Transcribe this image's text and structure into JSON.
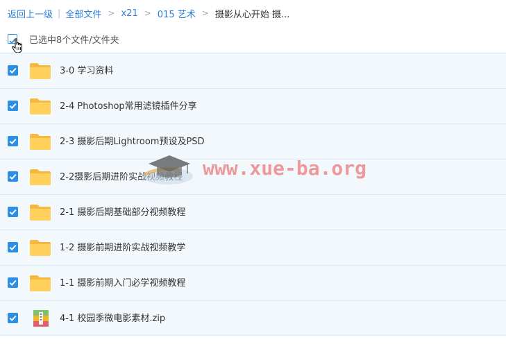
{
  "breadcrumb": {
    "back": "返回上一级",
    "all_files": "全部文件",
    "crumbs": [
      "x21",
      "015 艺术"
    ],
    "current": "摄影从心开始 摄..."
  },
  "selection": {
    "label": "已选中8个文件/文件夹"
  },
  "files": [
    {
      "name": "3-0 学习资料",
      "type": "folder",
      "checked": true
    },
    {
      "name": "2-4 Photoshop常用滤镜插件分享",
      "type": "folder",
      "checked": true
    },
    {
      "name": "2-3 摄影后期Lightroom预设及PSD",
      "type": "folder",
      "checked": true
    },
    {
      "name": "2-2摄影后期进阶实战视频教程",
      "type": "folder",
      "checked": true
    },
    {
      "name": "2-1 摄影后期基础部分视频教程",
      "type": "folder",
      "checked": true
    },
    {
      "name": "1-2 摄影前期进阶实战视频教学",
      "type": "folder",
      "checked": true
    },
    {
      "name": "1-1 摄影前期入门必学视频教程",
      "type": "folder",
      "checked": true
    },
    {
      "name": "4-1 校园季微电影素材.zip",
      "type": "zip",
      "checked": true
    }
  ],
  "watermark": {
    "text": "www.xue-ba.org"
  },
  "colors": {
    "link": "#2b7fd9",
    "check": "#2c8fe6",
    "folder": "#ffd05b",
    "row_bg": "#f3f8fd"
  },
  "icons": {
    "folder": "folder-icon",
    "zip": "zip-archive-icon",
    "check": "checkmark-icon",
    "cursor": "hand-cursor-icon"
  }
}
